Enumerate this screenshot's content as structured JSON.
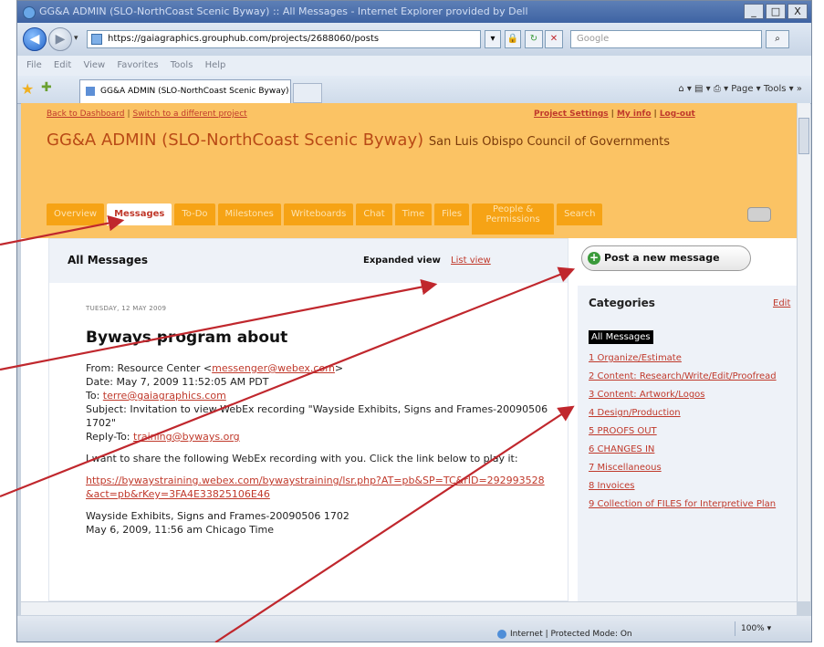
{
  "browser": {
    "title": "GG&A ADMIN (SLO-NorthCoast Scenic Byway) :: All Messages - Internet Explorer provided by Dell",
    "window_buttons": [
      "_",
      "□",
      "X"
    ],
    "url": "https://gaiagraphics.grouphub.com/projects/2688060/posts",
    "search_placeholder": "Google",
    "menu": [
      "File",
      "Edit",
      "View",
      "Favorites",
      "Tools",
      "Help"
    ],
    "tab_label": "GG&A ADMIN (SLO-NorthCoast Scenic Byway) > All M...",
    "command_bar": "Page ▾   Tools ▾",
    "status_zone": "Internet | Protected Mode: On",
    "zoom": "100%"
  },
  "page": {
    "top_links_left": [
      "Back to Dashboard",
      "Switch to a different project"
    ],
    "top_links_right": [
      "Project Settings",
      "My info",
      "Log-out"
    ],
    "project_title": "GG&A ADMIN (SLO-NorthCoast Scenic Byway)",
    "project_subtitle": "San Luis Obispo Council of Governments",
    "tabs": [
      {
        "label": "Overview"
      },
      {
        "label": "Messages"
      },
      {
        "label": "To-Do"
      },
      {
        "label": "Milestones"
      },
      {
        "label": "Writeboards"
      },
      {
        "label": "Chat"
      },
      {
        "label": "Time"
      },
      {
        "label": "Files"
      },
      {
        "label": "People & Permissions"
      },
      {
        "label": "Search"
      }
    ],
    "main": {
      "heading": "All Messages",
      "expanded_view": "Expanded view",
      "list_view": "List view",
      "date": "TUESDAY, 12 MAY 2009",
      "message_title": "Byways program about",
      "from_prefix": "From: Resource Center <",
      "from_email": "messenger@webex.com",
      "from_suffix": ">",
      "date_line": "Date: May 7, 2009 11:52:05 AM PDT",
      "to_prefix": "To: ",
      "to_email": "terre@gaiagraphics.com",
      "subject_line": "Subject: Invitation to view WebEx recording \"Wayside Exhibits, Signs and Frames-20090506 1702\"",
      "reply_prefix": "Reply-To: ",
      "reply_email": "training@byways.org",
      "share_text": "I want to share the following WebEx recording with you. Click the link below to play it:",
      "recording_url": "https://bywaystraining.webex.com/bywaystraining/lsr.php?AT=pb&SP=TC&rID=292993528&act=pb&rKey=3FA4E33825106E46",
      "recording_name": "Wayside Exhibits, Signs and Frames-20090506 1702",
      "recording_time": "May 6, 2009, 11:56 am Chicago Time"
    },
    "sidebar": {
      "post_button": "Post a new message",
      "categories_heading": "Categories",
      "edit_link": "Edit",
      "categories": [
        "All Messages",
        "1 Organize/Estimate",
        "2 Content: Research/Write/Edit/Proofread",
        "3 Content: Artwork/Logos",
        "4 Design/Production",
        "5 PROOFS OUT",
        "6 CHANGES IN",
        "7 Miscellaneous",
        "8 Invoices",
        "9 Collection of FILES for Interpretive Plan"
      ]
    }
  },
  "colors": {
    "header_orange": "#fbc364",
    "tab_orange": "#f6a315",
    "link_red": "#c0392b",
    "arrow_red": "#c0272d"
  }
}
